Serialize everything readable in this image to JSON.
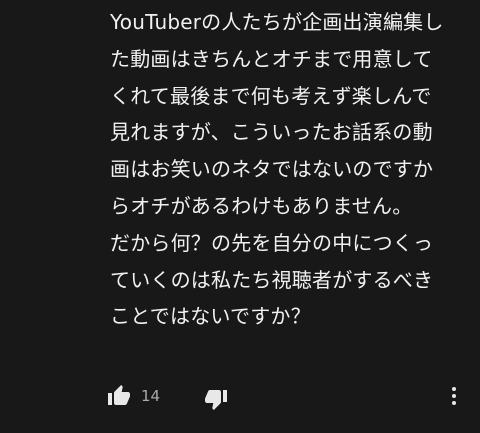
{
  "comment": {
    "lines": [
      "YouTuberの人たちが企画出演編集し",
      "た動画はきちんとオチまで用意して",
      "くれて最後まで何も考えず楽しんで",
      "見れますが、こういったお話系の動",
      "画はお笑いのネタではないのですか",
      "らオチがあるわけもありません。",
      "だから何？の先を自分の中につくっ",
      "ていくのは私たち視聴者がするべき",
      "ことではないですか？"
    ]
  },
  "actions": {
    "like_icon": "thumbs-up-icon",
    "like_count": "14",
    "dislike_icon": "thumbs-down-icon",
    "more_icon": "more-vertical-icon"
  },
  "colors": {
    "background": "#181818",
    "text": "#f1f1f1",
    "secondary_text": "#aaaaaa",
    "icon": "#e8e8e8"
  }
}
